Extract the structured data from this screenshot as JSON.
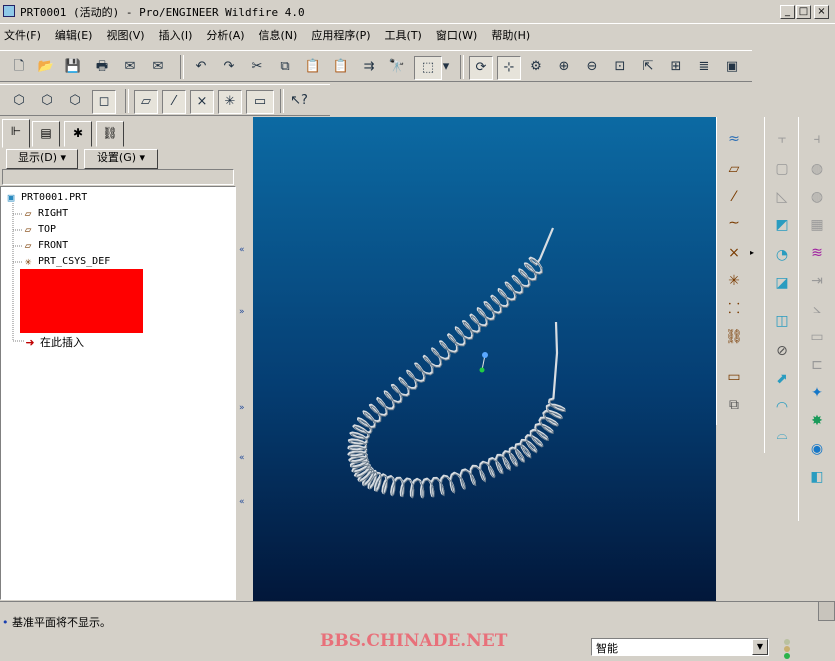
{
  "window": {
    "title": "PRT0001 (活动的) - Pro/ENGINEER Wildfire 4.0",
    "minimize": "_",
    "maximize": "□",
    "close": "×"
  },
  "menu": [
    "文件(F)",
    "编辑(E)",
    "视图(V)",
    "插入(I)",
    "分析(A)",
    "信息(N)",
    "应用程序(P)",
    "工具(T)",
    "窗口(W)",
    "帮助(H)"
  ],
  "left_panel": {
    "display_label": "显示(D) ▾",
    "settings_label": "设置(G) ▾",
    "tree": {
      "root": "PRT0001.PRT",
      "items": [
        "RIGHT",
        "TOP",
        "FRONT",
        "PRT_CSYS_DEF"
      ],
      "insert_here": "在此插入"
    }
  },
  "status": {
    "message": "基准平面将不显示。",
    "watermark": "BBS.CHINADE.NET",
    "filter_value": "智能"
  },
  "colors": {
    "viewport_top": "#0c6aa3",
    "viewport_bottom": "#02173a",
    "spring": "#d8dde2",
    "redaction": "#ff0000"
  }
}
